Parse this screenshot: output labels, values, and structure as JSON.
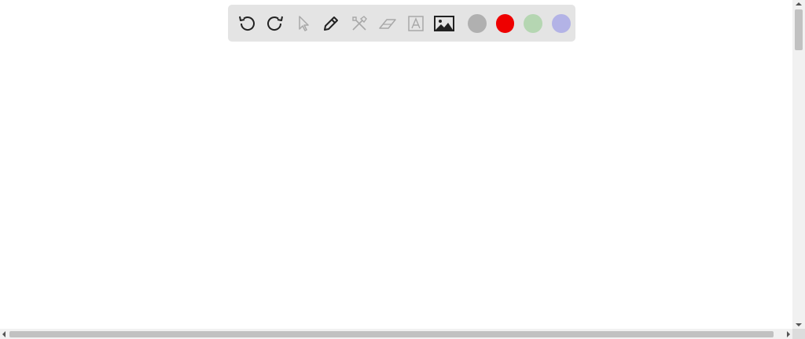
{
  "toolbar": {
    "tools": [
      {
        "name": "undo",
        "icon": "undo-icon",
        "enabled": true
      },
      {
        "name": "redo",
        "icon": "redo-icon",
        "enabled": true
      },
      {
        "name": "select",
        "icon": "pointer-icon",
        "enabled": false
      },
      {
        "name": "pen",
        "icon": "pencil-icon",
        "enabled": true
      },
      {
        "name": "tools",
        "icon": "crossed-tools-icon",
        "enabled": false
      },
      {
        "name": "eraser",
        "icon": "eraser-icon",
        "enabled": false
      },
      {
        "name": "text",
        "icon": "text-box-icon",
        "enabled": false
      },
      {
        "name": "image",
        "icon": "image-icon",
        "enabled": true
      }
    ],
    "colors": [
      {
        "name": "gray",
        "hex": "#b0b0b0"
      },
      {
        "name": "red",
        "hex": "#ee0000"
      },
      {
        "name": "green",
        "hex": "#b5d6b2"
      },
      {
        "name": "lavender",
        "hex": "#b3b3e6"
      }
    ]
  },
  "colors": {
    "toolbar_bg": "#e4e4e4",
    "icon_active": "#222222",
    "icon_disabled": "#a8a8a8",
    "scrollbar_track": "#f1f1f1",
    "scrollbar_thumb": "#c1c1c1"
  }
}
